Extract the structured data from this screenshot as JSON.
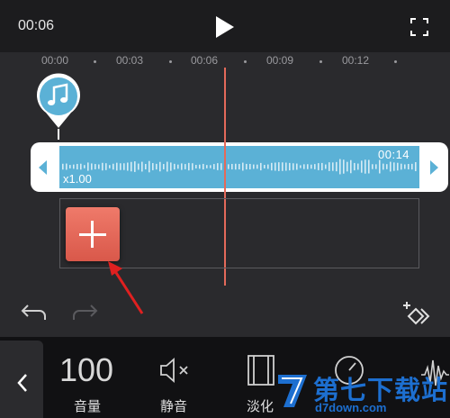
{
  "header": {
    "current_time": "00:06"
  },
  "timeline": {
    "ticks": [
      "00:00",
      "00:03",
      "00:06",
      "00:09",
      "00:12"
    ]
  },
  "audio_clip": {
    "duration": "00:14",
    "speed": "x1.00"
  },
  "toolbar": {
    "volume_value": "100",
    "volume_label": "音量",
    "mute_label": "静音",
    "fade_label": "淡化"
  },
  "watermark": {
    "title": "第七下载站",
    "url": "d7down.com"
  },
  "colors": {
    "accent": "#e46a5a",
    "clip": "#5bb1d6",
    "add_button": "#e0604f",
    "watermark": "#1d6fd0"
  },
  "icons": [
    "play-icon",
    "fullscreen-icon",
    "music-note-icon",
    "undo-icon",
    "redo-icon",
    "keyframe-icon",
    "chevron-left-icon",
    "mute-icon",
    "fade-icon",
    "speed-icon",
    "waveform-icon"
  ]
}
